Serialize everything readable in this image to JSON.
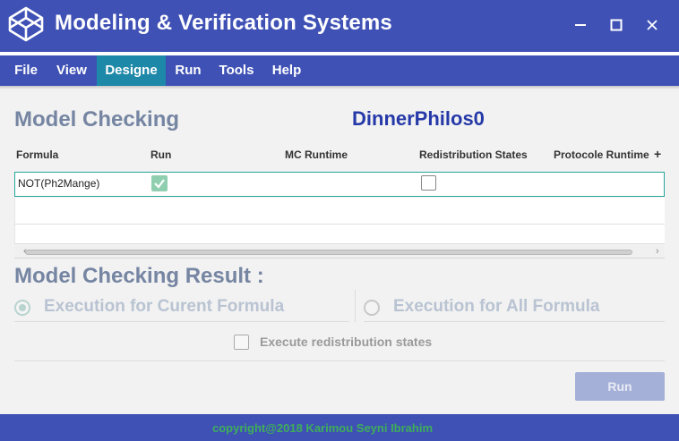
{
  "window": {
    "title": "Modeling & Verification Systems",
    "logo_icon": "codepen-cube-icon",
    "controls": {
      "minimize_icon": "minimize-icon",
      "maximize_icon": "maximize-icon",
      "close_icon": "close-icon"
    }
  },
  "menu": {
    "items": [
      {
        "label": "File",
        "active": false
      },
      {
        "label": "View",
        "active": false
      },
      {
        "label": "Designe",
        "active": true
      },
      {
        "label": "Run",
        "active": false
      },
      {
        "label": "Tools",
        "active": false
      },
      {
        "label": "Help",
        "active": false
      }
    ]
  },
  "model_checking": {
    "title": "Model Checking",
    "model_name": "DinnerPhilos0",
    "columns": [
      "Formula",
      "Run",
      "MC Runtime",
      "Redistribution States",
      "Protocole Runtime"
    ],
    "add_column_icon": "plus-icon",
    "rows": [
      {
        "formula": "NOT(Ph2Mange)",
        "run": true,
        "mc_runtime": "",
        "redistribution_states": false,
        "protocole_runtime": ""
      }
    ]
  },
  "result": {
    "title": "Model Checking Result  :",
    "options": [
      {
        "label": "Execution for Curent Formula",
        "selected": true
      },
      {
        "label": "Execution for All Formula",
        "selected": false
      }
    ],
    "execute_redistribution_label": "Execute  redistribution states",
    "execute_redistribution_checked": false,
    "run_button": "Run"
  },
  "footer": {
    "text": "copyright@2018 Karimou Seyni Ibrahim"
  },
  "colors": {
    "primary": "#3f51b5",
    "menu_active": "#1e88a8",
    "section_title": "#7585a2",
    "model_name": "#2639a8",
    "footer_text": "#3fae5a",
    "run_button": "#a5b0d8"
  }
}
